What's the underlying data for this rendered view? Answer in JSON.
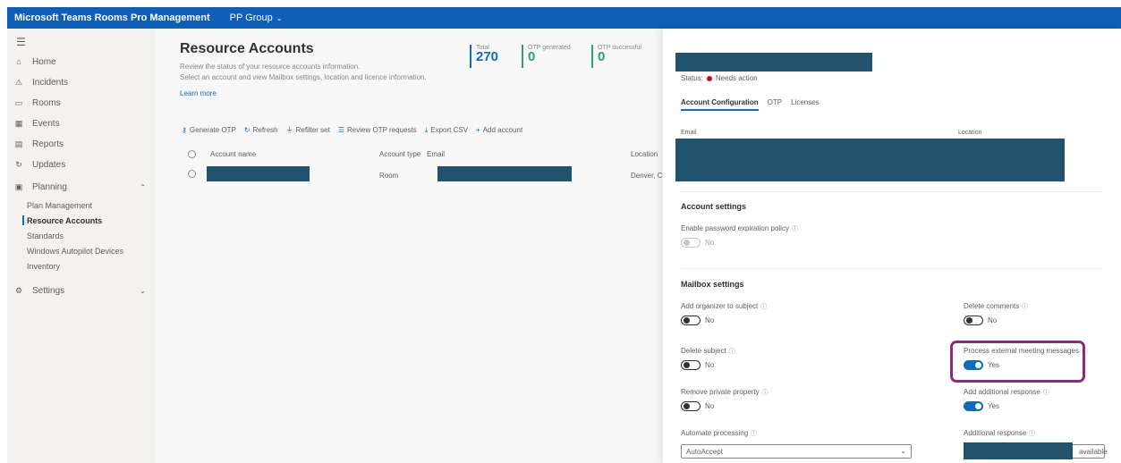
{
  "header": {
    "app_title": "Microsoft Teams Rooms Pro Management",
    "tenant": "PP Group",
    "tenant_chevron": "⌄",
    "colors": {
      "brand": "#0f5fb8"
    }
  },
  "sidebar": {
    "menu_icon": "☰",
    "items": [
      {
        "label": "Home",
        "icon": "home-icon",
        "glyph": "⌂"
      },
      {
        "label": "Incidents",
        "icon": "alert-icon",
        "glyph": "⚠"
      },
      {
        "label": "Rooms",
        "icon": "rooms-icon",
        "glyph": "▭"
      },
      {
        "label": "Events",
        "icon": "calendar-icon",
        "glyph": "▦"
      },
      {
        "label": "Reports",
        "icon": "reports-icon",
        "glyph": "▤"
      },
      {
        "label": "Updates",
        "icon": "updates-icon",
        "glyph": "↻"
      },
      {
        "label": "Planning",
        "icon": "planning-icon",
        "glyph": "▣",
        "chevron": "⌃"
      }
    ],
    "sub_items": [
      {
        "label": "Plan Management",
        "active": false
      },
      {
        "label": "Resource Accounts",
        "active": true
      },
      {
        "label": "Standards",
        "active": false
      },
      {
        "label": "Windows Autopilot Devices",
        "active": false
      },
      {
        "label": "Inventory",
        "active": false
      }
    ],
    "settings": {
      "label": "Settings",
      "icon": "gear-icon",
      "glyph": "⚙",
      "chevron": "⌄"
    }
  },
  "main": {
    "title": "Resource Accounts",
    "description_1": "Review the status of your resource accounts information.",
    "description_2": "Select an account and view Mailbox settings, location and licence information.",
    "learn_more": "Learn more",
    "stats": [
      {
        "label": "Total",
        "value": "270",
        "color": "#0f6cbd"
      },
      {
        "label": "OTP generated",
        "value": "0",
        "color": "#2aa07c"
      },
      {
        "label": "OTP successful",
        "value": "0",
        "color": "#2aa07c"
      }
    ],
    "toolbar": [
      {
        "label": "Generate OTP",
        "icon": "key-icon",
        "glyph": "⚷"
      },
      {
        "label": "Refresh",
        "icon": "refresh-icon",
        "glyph": "↻"
      },
      {
        "label": "Refilter set",
        "icon": "filter-icon",
        "glyph": "⏚"
      },
      {
        "label": "Review OTP requests",
        "icon": "review-icon",
        "glyph": "☰"
      },
      {
        "label": "Export CSV",
        "icon": "export-icon",
        "glyph": "⤓"
      },
      {
        "label": "Add account",
        "icon": "add-icon",
        "glyph": "+"
      }
    ],
    "columns": {
      "name": "Account name",
      "type": "Account type",
      "email": "Email",
      "location": "Location"
    },
    "rows": [
      {
        "type": "Room",
        "location": "Denver, C"
      }
    ]
  },
  "panel": {
    "status_label": "Status:",
    "status_value": "Needs action",
    "tabs": [
      {
        "label": "Account Configuration",
        "active": true
      },
      {
        "label": "OTP",
        "active": false
      },
      {
        "label": "Licenses",
        "active": false
      }
    ],
    "table_headers": {
      "email": "Email",
      "location": "Location"
    },
    "account_settings": {
      "title": "Account settings",
      "password_label": "Enable password expiration policy",
      "password_state": "No"
    },
    "mailbox_settings": {
      "title": "Mailbox settings",
      "add_organizer": {
        "label": "Add organizer to subject",
        "state": "No"
      },
      "delete_comments": {
        "label": "Delete comments",
        "state": "No"
      },
      "delete_subject": {
        "label": "Delete subject",
        "state": "No"
      },
      "process_external": {
        "label": "Process external meeting messages",
        "state": "Yes"
      },
      "remove_private": {
        "label": "Remove private property",
        "state": "No"
      },
      "add_additional": {
        "label": "Add additional response",
        "state": "Yes"
      },
      "automate_processing": {
        "label": "Automate processing",
        "value": "AutoAccept"
      },
      "additional_response": {
        "label": "Additional response",
        "value": "available"
      }
    },
    "info_glyph": "ⓘ",
    "select_chevron": "⌄",
    "colors": {
      "highlight": "#8a2c7d",
      "toggle_on": "#0f6cbd",
      "redaction": "#22536d"
    }
  }
}
